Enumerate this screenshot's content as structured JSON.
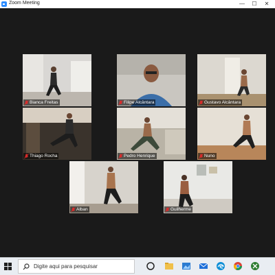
{
  "window": {
    "title": "Zoom Meeting",
    "controls": {
      "minimize": "—",
      "maximize": "☐",
      "close": "✕"
    }
  },
  "participants": [
    {
      "name": "Bianca Freitas",
      "muted": true
    },
    {
      "name": "Filipe Alcântara",
      "muted": true
    },
    {
      "name": "Gustavo Alcântara",
      "muted": true
    },
    {
      "name": "Thiago Rocha",
      "muted": true
    },
    {
      "name": "Pedro Henrique",
      "muted": true
    },
    {
      "name": "Nuno",
      "muted": true
    },
    {
      "name": "Alban",
      "muted": true
    },
    {
      "name": "Guilherme",
      "muted": true
    }
  ],
  "taskbar": {
    "search_placeholder": "Digite aqui para pesquisar",
    "icons": [
      "windows-start-icon",
      "search-icon",
      "task-view-icon",
      "file-explorer-icon",
      "photos-icon",
      "mail-icon",
      "edge-icon",
      "chrome-icon",
      "xbox-icon"
    ]
  },
  "colors": {
    "gallery_bg": "#1a1a1a",
    "taskbar_bg": "#e9edf2",
    "muted_mic": "#e02b2b",
    "zoom_blue": "#2d8cff"
  }
}
